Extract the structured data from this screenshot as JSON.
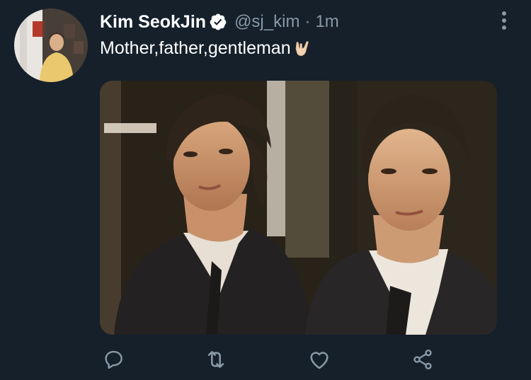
{
  "tweet": {
    "display_name": "Kim SeokJin",
    "handle": "@sj_kim",
    "separator": "·",
    "time": "1m",
    "text": "Mother,father,gentleman"
  },
  "icons": {
    "verified": "verified-badge-icon",
    "more": "more-vertical-icon",
    "emoji": "rock-on-hand-emoji-icon",
    "reply": "reply-icon",
    "retweet": "retweet-icon",
    "like": "heart-icon",
    "share": "share-icon"
  },
  "colors": {
    "background": "#15202b",
    "secondary_text": "#8899a6",
    "primary_text": "#ffffff"
  }
}
